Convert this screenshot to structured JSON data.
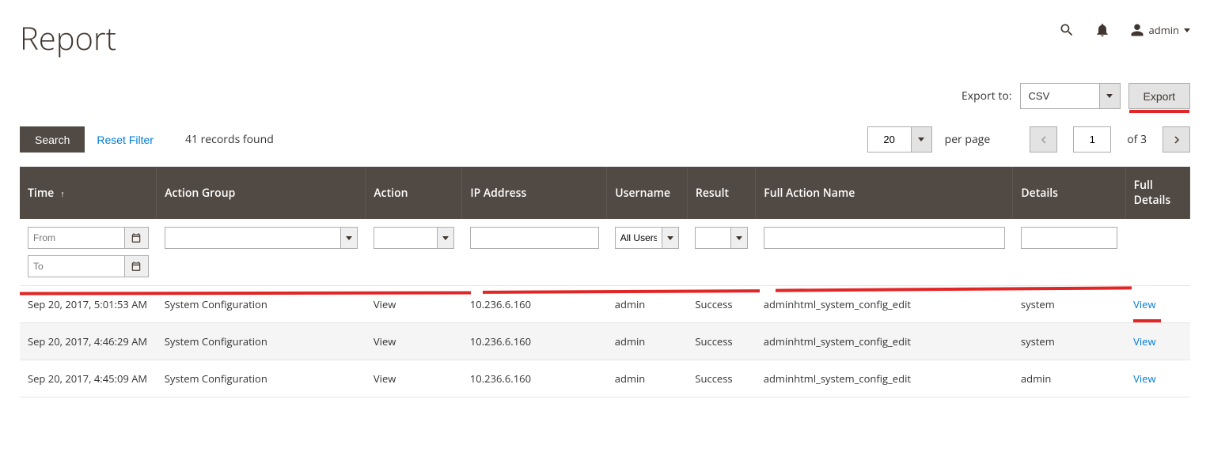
{
  "header": {
    "title": "Report",
    "admin_label": "admin"
  },
  "export": {
    "label": "Export to:",
    "format": "CSV",
    "button": "Export"
  },
  "toolbar": {
    "search": "Search",
    "reset": "Reset Filter",
    "records_found": "41 records found",
    "per_page_value": "20",
    "per_page_label": "per page",
    "page_current": "1",
    "page_of": "of 3"
  },
  "columns": {
    "time": "Time",
    "action_group": "Action Group",
    "action": "Action",
    "ip": "IP Address",
    "username": "Username",
    "result": "Result",
    "full_action": "Full Action Name",
    "details": "Details",
    "full_details": "Full Details"
  },
  "filters": {
    "from_placeholder": "From",
    "to_placeholder": "To",
    "username_value": "All Users"
  },
  "rows": [
    {
      "time": "Sep 20, 2017, 5:01:53 AM",
      "action_group": "System Configuration",
      "action": "View",
      "ip": "10.236.6.160",
      "username": "admin",
      "result": "Success",
      "full_action": "adminhtml_system_config_edit",
      "details": "system",
      "link": "View"
    },
    {
      "time": "Sep 20, 2017, 4:46:29 AM",
      "action_group": "System Configuration",
      "action": "View",
      "ip": "10.236.6.160",
      "username": "admin",
      "result": "Success",
      "full_action": "adminhtml_system_config_edit",
      "details": "system",
      "link": "View"
    },
    {
      "time": "Sep 20, 2017, 4:45:09 AM",
      "action_group": "System Configuration",
      "action": "View",
      "ip": "10.236.6.160",
      "username": "admin",
      "result": "Success",
      "full_action": "adminhtml_system_config_edit",
      "details": "admin",
      "link": "View"
    }
  ]
}
